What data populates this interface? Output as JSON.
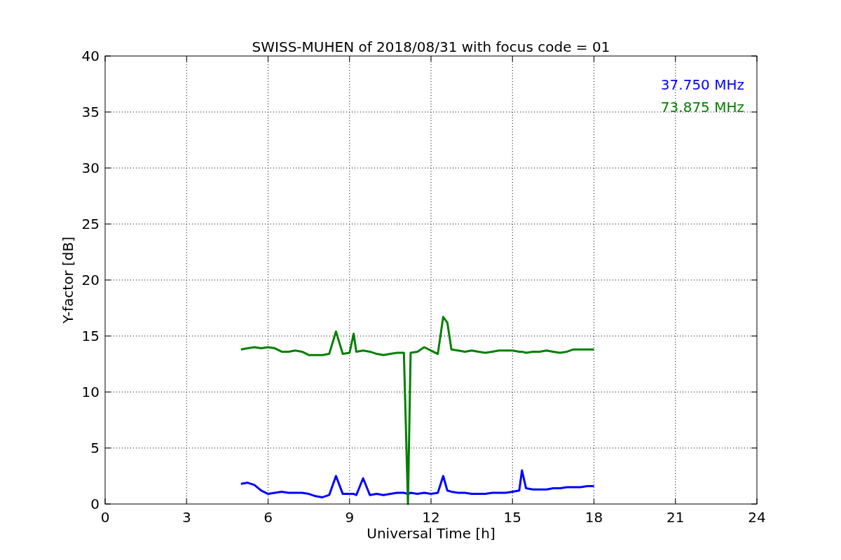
{
  "figure": {
    "chart_data": {
      "type": "line",
      "title": "SWISS-MUHEN of 2018/08/31 with focus code = 01",
      "xlabel": "Universal Time [h]",
      "ylabel": "Y-factor [dB]",
      "x": [
        5,
        5.25,
        5.5,
        5.75,
        6,
        6.25,
        6.5,
        6.75,
        7,
        7.25,
        7.5,
        7.75,
        8,
        8.25,
        8.5,
        8.75,
        9,
        9.15,
        9.25,
        9.5,
        9.75,
        10,
        10.25,
        10.5,
        10.75,
        11,
        11.15,
        11.25,
        11.5,
        11.75,
        12,
        12.25,
        12.45,
        12.6,
        12.75,
        13,
        13.25,
        13.5,
        13.75,
        14,
        14.25,
        14.5,
        14.75,
        15,
        15.25,
        15.35,
        15.5,
        15.75,
        16,
        16.25,
        16.5,
        16.75,
        17,
        17.25,
        17.5,
        17.75,
        18
      ],
      "series": [
        {
          "name": "37.750 MHz",
          "color": "#0000ff",
          "values": [
            1.8,
            1.9,
            1.7,
            1.2,
            0.9,
            1.0,
            1.1,
            1.0,
            1.0,
            1.0,
            0.9,
            0.7,
            0.6,
            0.8,
            2.5,
            0.9,
            0.9,
            0.9,
            0.8,
            2.3,
            0.8,
            0.9,
            0.8,
            0.9,
            1.0,
            1.0,
            0.9,
            1.0,
            0.9,
            1.0,
            0.9,
            1.0,
            2.5,
            1.2,
            1.1,
            1.0,
            1.0,
            0.9,
            0.9,
            0.9,
            1.0,
            1.0,
            1.0,
            1.1,
            1.2,
            3.0,
            1.4,
            1.3,
            1.3,
            1.3,
            1.4,
            1.4,
            1.5,
            1.5,
            1.5,
            1.6,
            1.6
          ]
        },
        {
          "name": "73.875 MHz",
          "color": "#008000",
          "values": [
            13.8,
            13.9,
            14.0,
            13.9,
            14.0,
            13.9,
            13.6,
            13.6,
            13.7,
            13.6,
            13.3,
            13.3,
            13.3,
            13.4,
            15.4,
            13.4,
            13.5,
            15.2,
            13.6,
            13.7,
            13.6,
            13.4,
            13.3,
            13.4,
            13.5,
            13.5,
            0,
            13.5,
            13.6,
            14.0,
            13.7,
            13.4,
            16.7,
            16.2,
            13.8,
            13.7,
            13.6,
            13.7,
            13.6,
            13.5,
            13.6,
            13.7,
            13.7,
            13.7,
            13.6,
            13.6,
            13.5,
            13.6,
            13.6,
            13.7,
            13.6,
            13.5,
            13.6,
            13.8,
            13.8,
            13.8,
            13.8
          ]
        }
      ],
      "xlim": [
        0,
        24
      ],
      "ylim": [
        0,
        40
      ],
      "grid": true,
      "xticks": [
        0,
        3,
        6,
        9,
        12,
        15,
        18,
        21,
        24
      ],
      "yticks": [
        0,
        5,
        10,
        15,
        20,
        25,
        30,
        35,
        40
      ]
    }
  }
}
